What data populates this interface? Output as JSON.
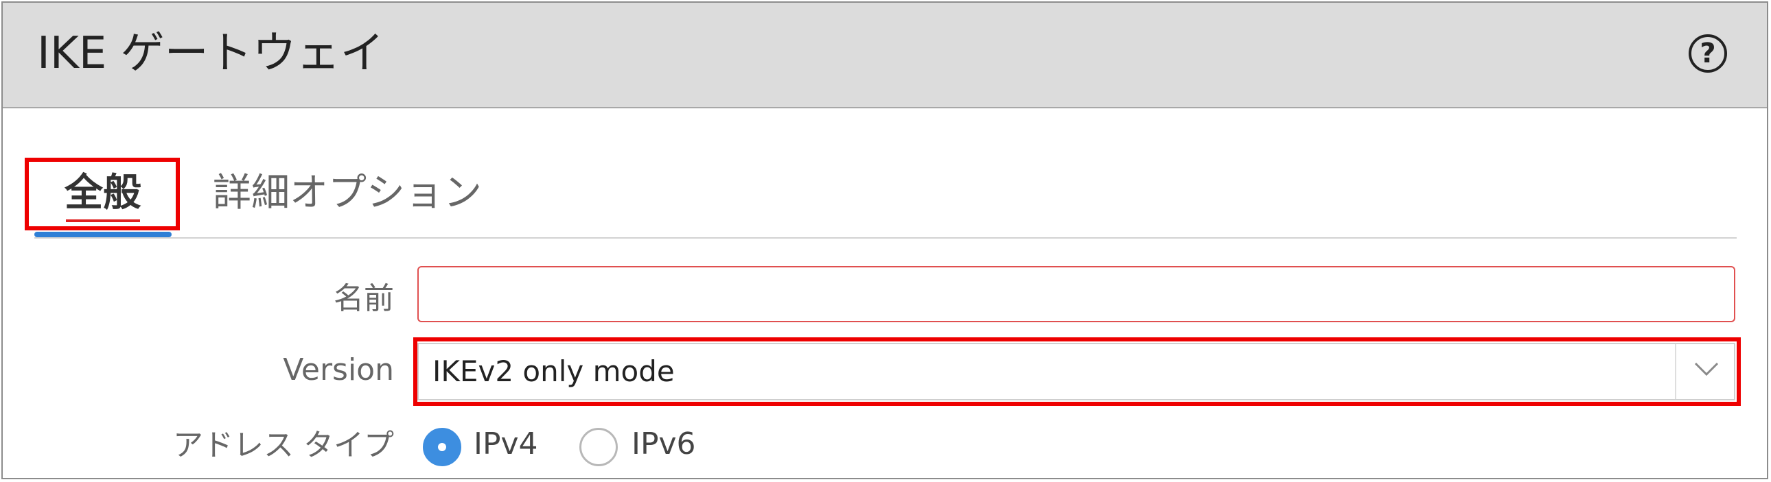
{
  "dialog": {
    "title": "IKE ゲートウェイ",
    "help_icon": "?"
  },
  "tabs": [
    {
      "label": "全般",
      "active": true
    },
    {
      "label": "詳細オプション",
      "active": false
    }
  ],
  "form": {
    "name": {
      "label": "名前",
      "value": ""
    },
    "version": {
      "label": "Version",
      "value": "IKEv2 only mode"
    },
    "address_type": {
      "label": "アドレス タイプ",
      "options": [
        {
          "label": "IPv4",
          "selected": true
        },
        {
          "label": "IPv6",
          "selected": false
        }
      ]
    }
  },
  "colors": {
    "highlight": "#ee0000",
    "accent": "#3d8ee0",
    "header_bg": "#dcdcdc"
  }
}
